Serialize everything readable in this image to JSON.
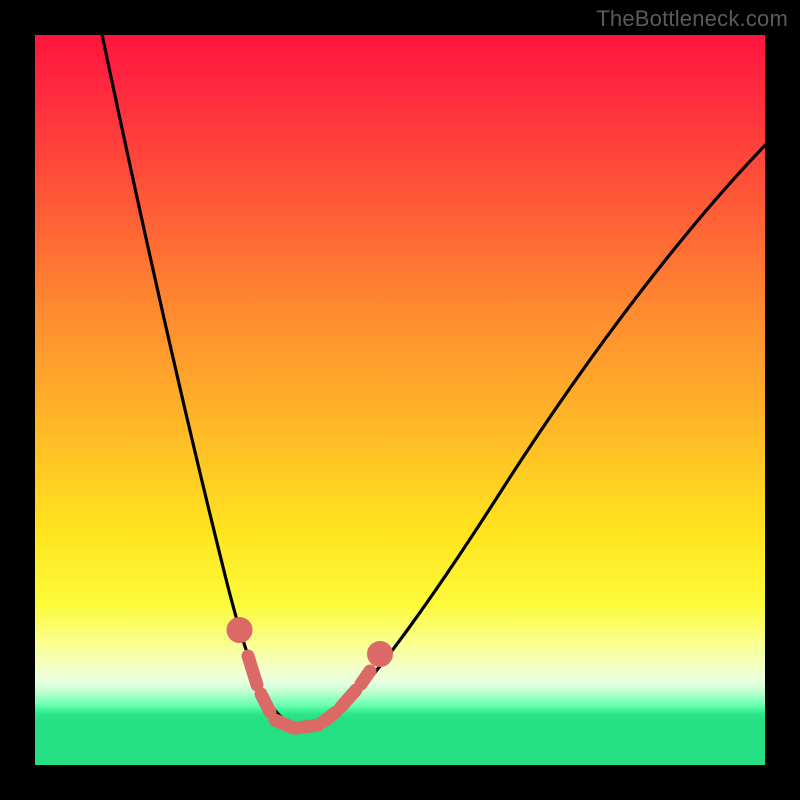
{
  "watermark": "TheBottleneck.com",
  "colors": {
    "frame_bg": "#000000",
    "curve_stroke": "#000000",
    "marker_fill": "#db6a66",
    "gradient_stops": [
      "#ff153c",
      "#ff5638",
      "#ffb328",
      "#ffe41e",
      "#faff8a",
      "#bfffd2",
      "#45f69e",
      "#24e083"
    ]
  },
  "chart_data": {
    "type": "line",
    "title": "",
    "xlabel": "",
    "ylabel": "",
    "x_range": [
      0,
      100
    ],
    "y_range": [
      0,
      100
    ],
    "grid": false,
    "series": [
      {
        "name": "bottleneck-curve",
        "x": [
          10,
          12,
          14,
          16,
          18,
          20,
          22,
          24,
          26,
          28,
          29,
          30,
          31,
          32,
          33,
          34,
          35,
          36,
          38,
          40,
          42,
          45,
          50,
          55,
          60,
          65,
          70,
          75,
          80,
          85,
          90,
          95,
          100
        ],
        "values": [
          100,
          90,
          80,
          70,
          60,
          50,
          41,
          33,
          25,
          18,
          14,
          10,
          7,
          5,
          3.5,
          2.8,
          2.5,
          2.5,
          2.5,
          3,
          4.5,
          7.5,
          14,
          21,
          28,
          35,
          41,
          47,
          53,
          58,
          63,
          68,
          72
        ]
      }
    ],
    "markers": {
      "name": "highlighted-range",
      "x": [
        28,
        30,
        31,
        32,
        33,
        34,
        35,
        36,
        37,
        38,
        39,
        40,
        42
      ],
      "values": [
        18,
        10,
        7,
        5,
        3.5,
        2.8,
        2.5,
        2.5,
        2.6,
        2.8,
        3.2,
        3.8,
        5.5
      ]
    }
  }
}
